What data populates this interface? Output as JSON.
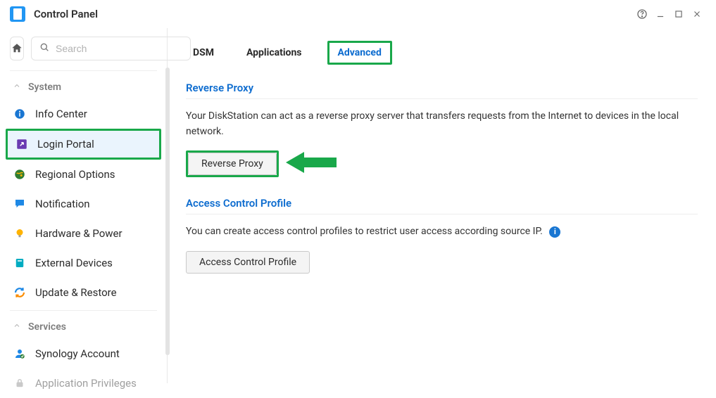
{
  "window": {
    "title": "Control Panel"
  },
  "search": {
    "placeholder": "Search"
  },
  "groups": {
    "system": {
      "label": "System",
      "items": [
        {
          "label": "Info Center"
        },
        {
          "label": "Login Portal"
        },
        {
          "label": "Regional Options"
        },
        {
          "label": "Notification"
        },
        {
          "label": "Hardware & Power"
        },
        {
          "label": "External Devices"
        },
        {
          "label": "Update & Restore"
        }
      ]
    },
    "services": {
      "label": "Services",
      "items": [
        {
          "label": "Synology Account"
        },
        {
          "label": "Application Privileges"
        }
      ]
    }
  },
  "tabs": {
    "dsm": "DSM",
    "applications": "Applications",
    "advanced": "Advanced"
  },
  "sections": {
    "reverse_proxy": {
      "title": "Reverse Proxy",
      "desc": "Your DiskStation can act as a reverse proxy server that transfers requests from the Internet to devices in the local network.",
      "button": "Reverse Proxy"
    },
    "access_control": {
      "title": "Access Control Profile",
      "desc": "You can create access control profiles to restrict user access according source IP.",
      "button": "Access Control Profile"
    }
  },
  "info_badge": "i"
}
